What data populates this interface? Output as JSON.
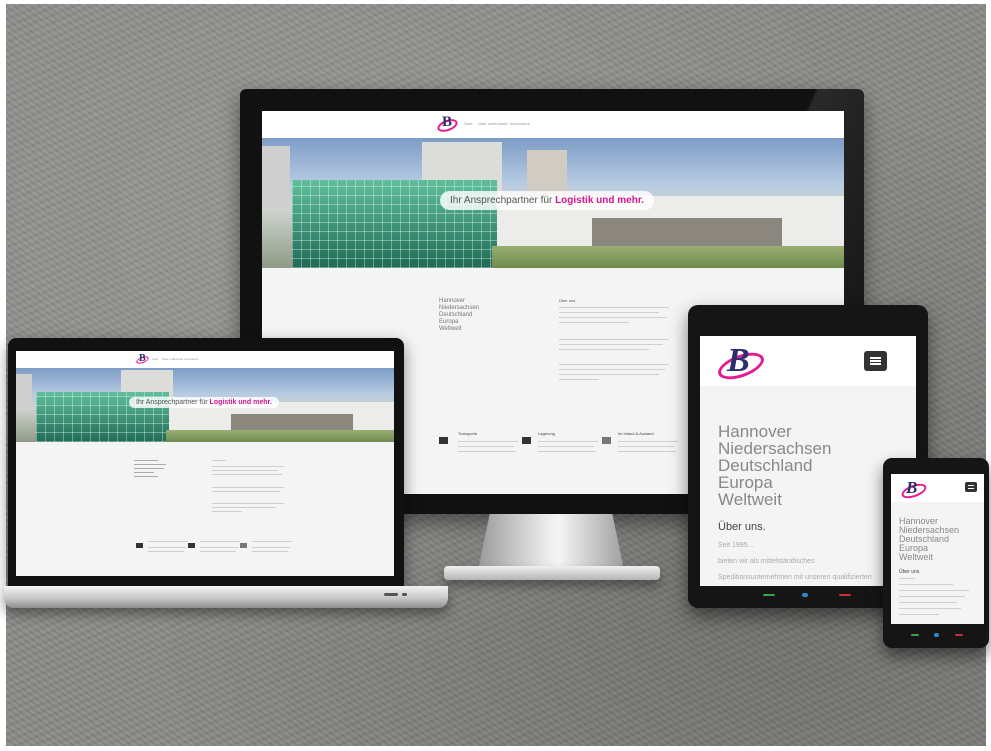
{
  "scene": {
    "description_label": "Responsive website mockup"
  },
  "site": {
    "tagline_prefix": "Ihr Ansprechpartner für",
    "tagline_highlight": "Logistik und mehr.",
    "nav": [
      "Start",
      "Über uns",
      "Kontakt",
      "Impressum"
    ],
    "places": [
      "Hannover",
      "Niedersachsen",
      "Deutschland",
      "Europa",
      "Weltweit"
    ],
    "about_heading": "Über uns.",
    "about_lines": [
      "Seit 1995...",
      "bieten wir als mittelständisches",
      "Speditionsunternehmen mit unseren qualifizierten"
    ],
    "services": [
      "Transporte",
      "Lagerung",
      "Im Inland & Ausland"
    ],
    "logo_letter": "B"
  },
  "colors": {
    "accent": "#d6158f",
    "logo_dark": "#2b2f6e",
    "menu_button": "#333333"
  },
  "icons": [
    "menu-icon",
    "truck-icon",
    "warehouse-icon",
    "phone-call-icon",
    "home-icon",
    "phone-end-icon"
  ]
}
